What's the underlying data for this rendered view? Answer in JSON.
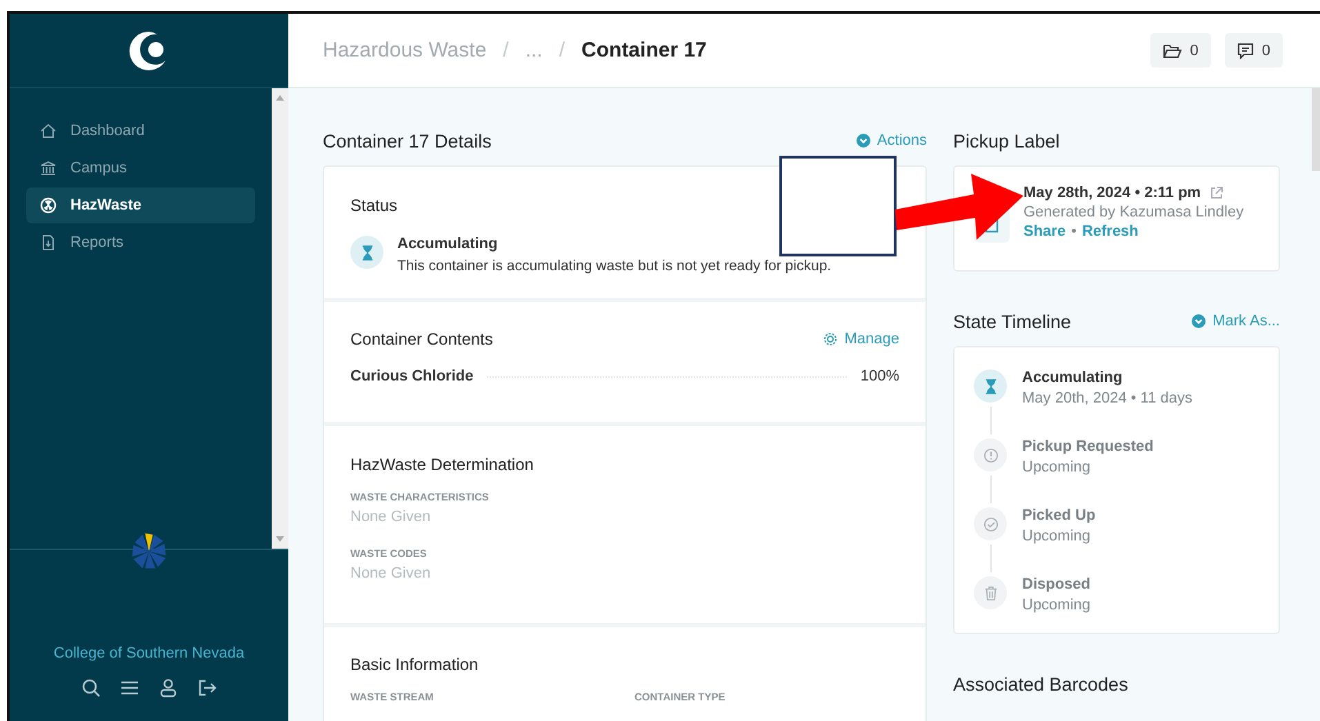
{
  "sidebar": {
    "nav": [
      {
        "label": "Dashboard",
        "kind": "home",
        "selected": false
      },
      {
        "label": "Campus",
        "kind": "bank",
        "selected": false
      },
      {
        "label": "HazWaste",
        "kind": "hazard",
        "selected": true
      },
      {
        "label": "Reports",
        "kind": "report",
        "selected": false
      }
    ],
    "org": "College of Southern Nevada"
  },
  "breadcrumbs": {
    "separator": "/",
    "items": [
      {
        "label": "Hazardous Waste",
        "current": false
      },
      {
        "label": "...",
        "current": false
      },
      {
        "label": "Container 17",
        "current": true
      }
    ]
  },
  "header_counts": [
    {
      "kind": "folder",
      "count": "0"
    },
    {
      "kind": "comment",
      "count": "0"
    }
  ],
  "details": {
    "title": "Container 17 Details",
    "action": "Actions",
    "status": {
      "title": "Status",
      "state": "Accumulating",
      "description": "This container is accumulating waste but is not yet ready for pickup."
    },
    "contents": {
      "title": "Container Contents",
      "action": "Manage",
      "items": [
        {
          "name": "Curious Chloride",
          "percent": "100%"
        }
      ]
    },
    "determination": {
      "title": "HazWaste Determination",
      "fields": [
        {
          "label": "WASTE CHARACTERISTICS",
          "value": "None Given"
        },
        {
          "label": "WASTE CODES",
          "value": "None Given"
        }
      ]
    },
    "basic": {
      "title": "Basic Information",
      "fields": [
        {
          "label": "WASTE STREAM"
        },
        {
          "label": "CONTAINER TYPE"
        }
      ]
    }
  },
  "pickup_label": {
    "title": "Pickup Label",
    "date": "May 28th, 2024 • 2:11 pm",
    "generated_by": "Generated by Kazumasa Lindley",
    "links": [
      "Share",
      "Refresh"
    ],
    "link_separator": "•"
  },
  "timeline": {
    "title": "State Timeline",
    "action": "Mark As...",
    "steps": [
      {
        "state": "Accumulating",
        "detail": "May 20th, 2024 • 11 days",
        "kind": "hourglass",
        "active": true
      },
      {
        "state": "Pickup Requested",
        "detail": "Upcoming",
        "kind": "alert",
        "active": false
      },
      {
        "state": "Picked Up",
        "detail": "Upcoming",
        "kind": "check",
        "active": false
      },
      {
        "state": "Disposed",
        "detail": "Upcoming",
        "kind": "trash",
        "active": false
      }
    ]
  },
  "barcodes": {
    "title": "Associated Barcodes"
  },
  "annotations": [
    {
      "kind": "box"
    },
    {
      "kind": "arrow"
    }
  ]
}
